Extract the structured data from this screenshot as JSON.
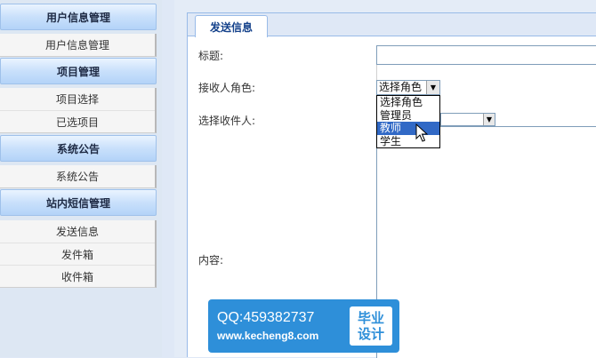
{
  "sidebar": {
    "groups": [
      {
        "title": "用户信息管理",
        "items": [
          "用户信息管理"
        ]
      },
      {
        "title": "项目管理",
        "items": [
          "项目选择",
          "已选项目"
        ]
      },
      {
        "title": "系统公告",
        "items": [
          "系统公告"
        ]
      },
      {
        "title": "站内短信管理",
        "items": [
          "发送信息",
          "发件箱",
          "收件箱"
        ]
      }
    ]
  },
  "tab": {
    "label": "发送信息"
  },
  "form": {
    "title_label": "标题:",
    "role_label": "接收人角色:",
    "receiver_label": "选择收件人:",
    "content_label": "内容:",
    "title_value": "",
    "role_selected": "选择角色",
    "role_options": [
      "选择角色",
      "管理员",
      "教师",
      "学生"
    ],
    "role_highlighted": "教师",
    "receiver_selected": ""
  },
  "watermark": {
    "qq": "QQ:459382737",
    "site": "www.kecheng8.com",
    "badge_line1": "毕业",
    "badge_line2": "设计"
  },
  "colors": {
    "header_gradient": "#c9e0fb",
    "tab_text": "#15428b",
    "highlight": "#3169c6",
    "watermark_bg": "#2e8fd9"
  }
}
